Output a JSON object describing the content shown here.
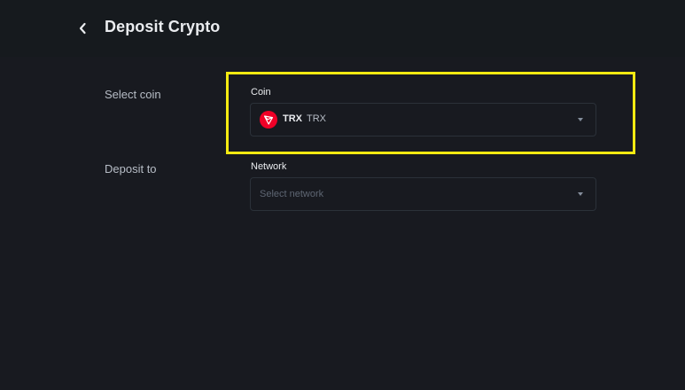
{
  "header": {
    "title": "Deposit Crypto",
    "back_icon": "chevron-left-icon"
  },
  "select_coin": {
    "row_label": "Select coin",
    "field_label": "Coin",
    "selected_symbol": "TRX",
    "selected_name": "TRX",
    "icon": "tron-icon",
    "icon_color": "#ef0027"
  },
  "deposit_to": {
    "row_label": "Deposit to",
    "field_label": "Network",
    "placeholder": "Select network"
  },
  "colors": {
    "background": "#181a20",
    "header": "#161a1e",
    "highlight": "#f4ea12"
  }
}
